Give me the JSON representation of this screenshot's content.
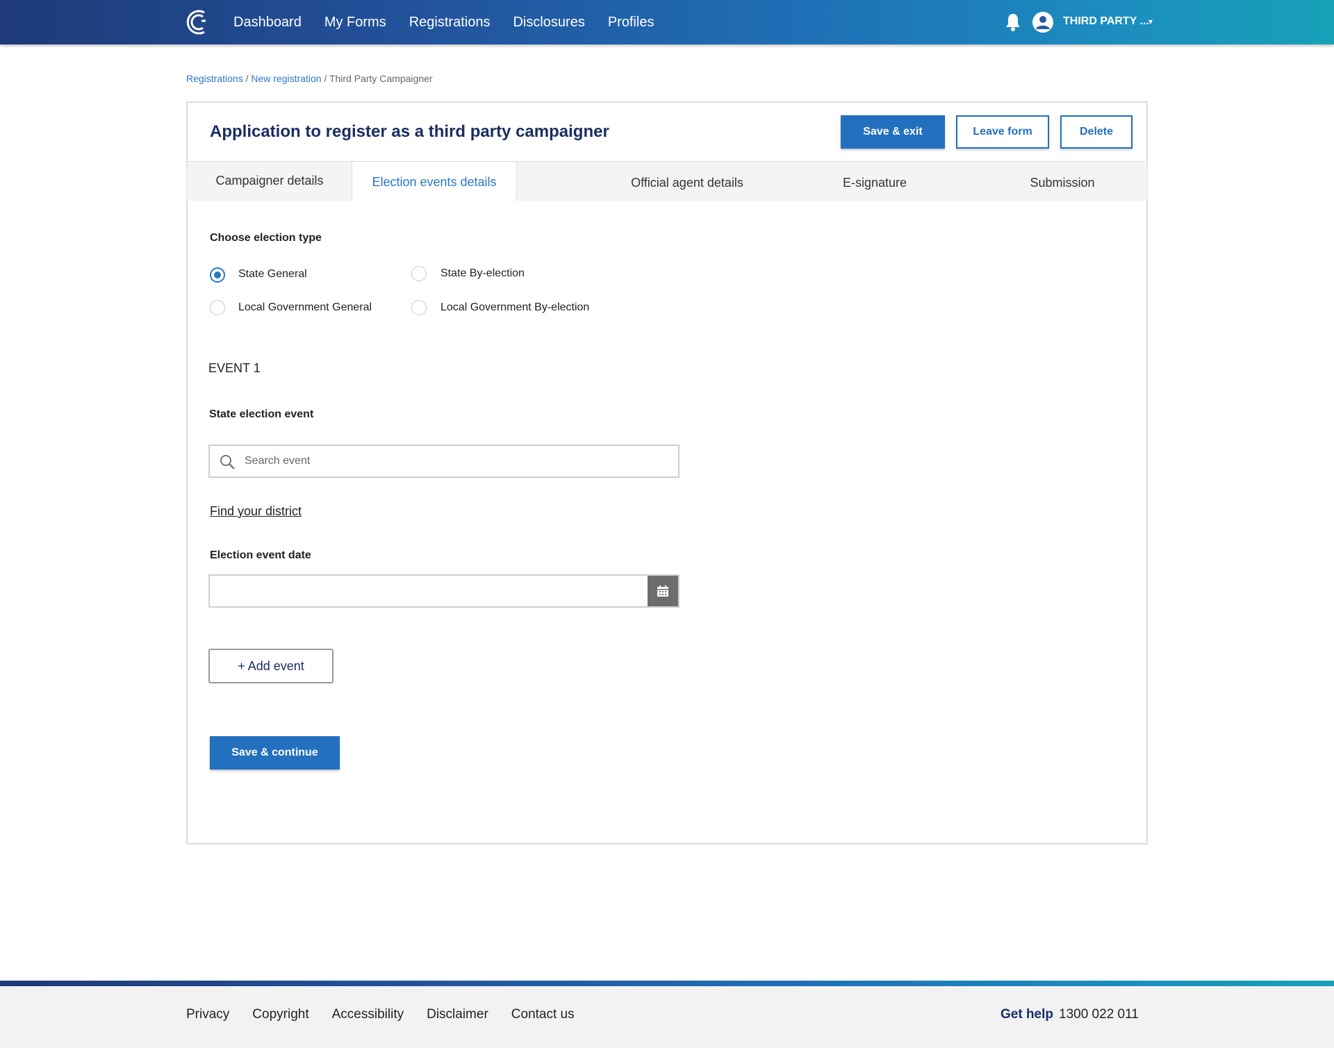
{
  "header": {
    "nav": [
      "Dashboard",
      "My Forms",
      "Registrations",
      "Disclosures",
      "Profiles"
    ],
    "user_name": "THIRD PARTY ...",
    "user_caret": "▾"
  },
  "breadcrumb": {
    "items": [
      "Registrations",
      "New registration"
    ],
    "separator": " / ",
    "current": "Third Party Campaigner"
  },
  "form": {
    "title": "Application to register as a third party campaigner",
    "save_exit_label": "Save & exit",
    "leave_label": "Leave form",
    "delete_label": "Delete"
  },
  "tabs": [
    {
      "label": "Campaigner details",
      "active": false
    },
    {
      "label": "Election events details",
      "active": true
    },
    {
      "label": "Official agent details",
      "active": false
    },
    {
      "label": "E-signature",
      "active": false
    },
    {
      "label": "Submission",
      "active": false
    }
  ],
  "election_type": {
    "label": "Choose election type",
    "options": [
      {
        "label": "State General",
        "checked": true
      },
      {
        "label": "State By-election",
        "checked": false
      },
      {
        "label": "Local Government General",
        "checked": false
      },
      {
        "label": "Local Government By-election",
        "checked": false
      }
    ]
  },
  "event": {
    "heading": "EVENT 1",
    "state_event_label": "State election event",
    "search_placeholder": "Search event",
    "search_value": "",
    "find_district_link": "Find your district",
    "date_label": "Election event date",
    "date_value": "",
    "add_event_label": "+ Add event",
    "save_continue_label": "Save & continue"
  },
  "footer": {
    "links": [
      "Privacy",
      "Copyright",
      "Accessibility",
      "Disclaimer",
      "Contact us"
    ],
    "help_label": "Get help",
    "help_phone": "1300 022 011"
  },
  "colors": {
    "primary": "#2270be",
    "title": "#1a2e63",
    "link": "#2b77c5"
  }
}
